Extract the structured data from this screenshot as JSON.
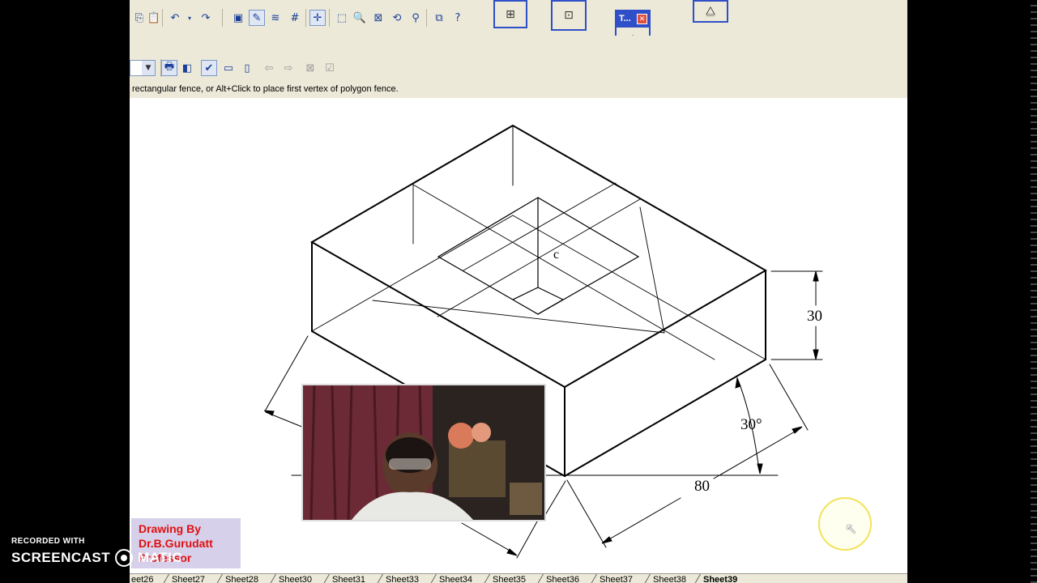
{
  "status": {
    "prompt": "rectangular fence, or Alt+Click to place first vertex of polygon fence."
  },
  "floating_toolbox": {
    "title": "T...",
    "close": "✕"
  },
  "toolbar": {
    "icons": [
      "copy-icon",
      "paste-icon",
      "undo-icon",
      "redo-icon",
      "save-icon",
      "edit-icon",
      "line-style-icon",
      "grid-icon",
      "snap-icon",
      "zoom-window-icon",
      "zoom-in-icon",
      "fit-view-icon",
      "view-rotate-icon",
      "measure-icon",
      "pan-icon",
      "help-icon"
    ],
    "row2_icons": [
      "print-icon",
      "fill-icon",
      "check-icon",
      "rectangle-icon",
      "sheet-icon",
      "arrow-left-icon",
      "arrow-right-icon",
      "cancel-icon",
      "accept-icon"
    ]
  },
  "drawing": {
    "label_center": "c",
    "dim_height": "30",
    "dim_angle": "30°",
    "dim_length": "80"
  },
  "sheet_tabs": [
    {
      "label": "eet26",
      "active": false
    },
    {
      "label": "Sheet27",
      "active": false
    },
    {
      "label": "Sheet28",
      "active": false
    },
    {
      "label": "Sheet30",
      "active": false
    },
    {
      "label": "Sheet31",
      "active": false
    },
    {
      "label": "Sheet33",
      "active": false
    },
    {
      "label": "Sheet34",
      "active": false
    },
    {
      "label": "Sheet35",
      "active": false
    },
    {
      "label": "Sheet36",
      "active": false
    },
    {
      "label": "Sheet37",
      "active": false
    },
    {
      "label": "Sheet38",
      "active": false
    },
    {
      "label": "Sheet39",
      "active": true
    }
  ],
  "credit": {
    "line1": "Drawing By",
    "line2": "Dr.B.Gurudatt",
    "line3": "Professor"
  },
  "watermark": {
    "small": "RECORDED WITH",
    "big_left": "SCREENCAST",
    "big_right": "MATIC"
  },
  "colors": {
    "chrome": "#ece9d8",
    "accent": "#2f4fc8",
    "credit_text": "#e01010"
  }
}
